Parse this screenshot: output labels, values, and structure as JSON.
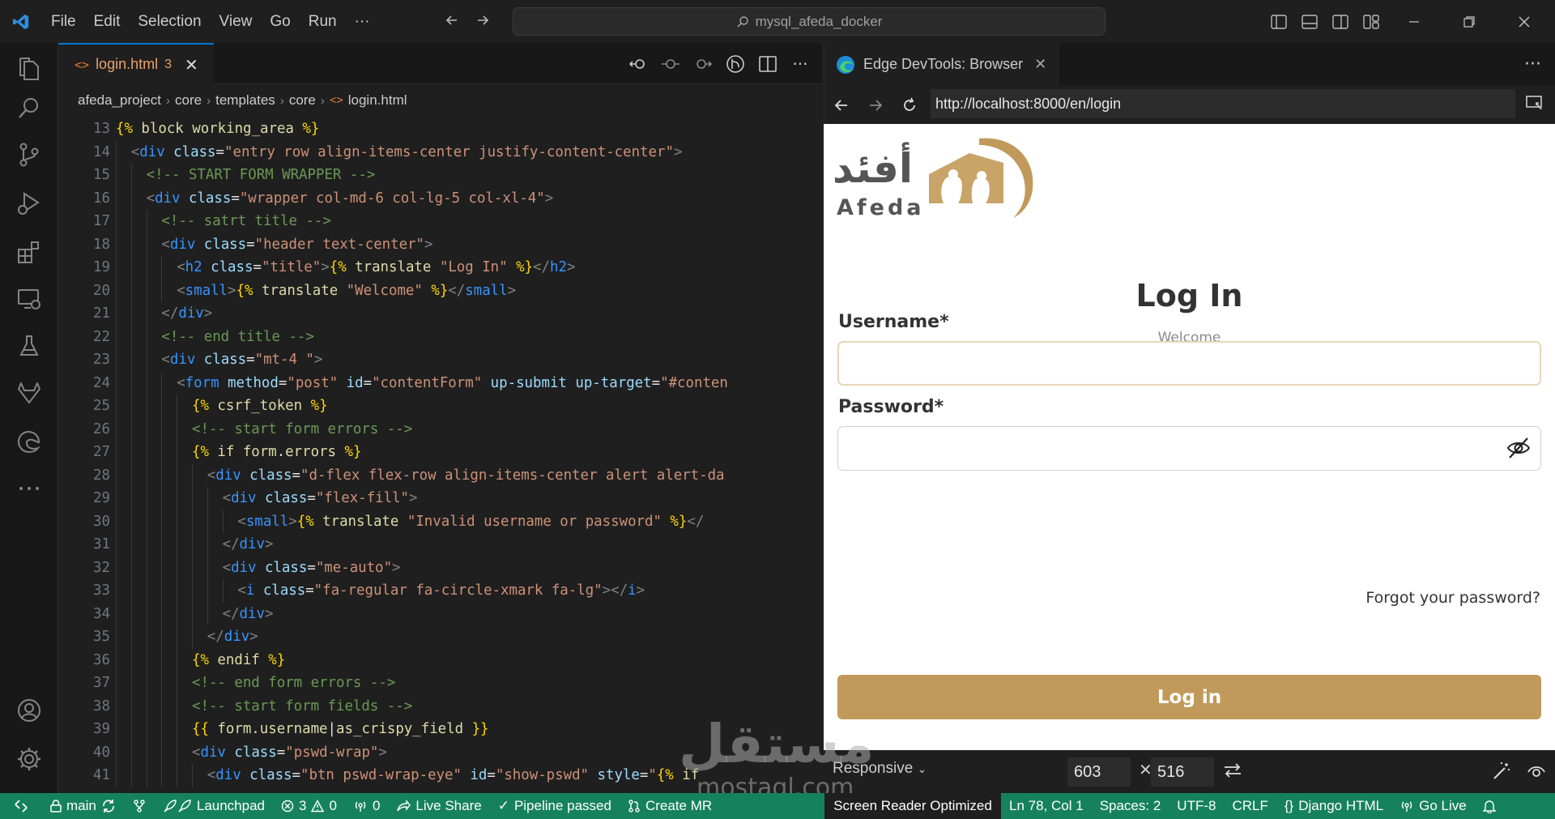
{
  "titlebar": {
    "menu": [
      "File",
      "Edit",
      "Selection",
      "View",
      "Go",
      "Run",
      "···"
    ],
    "search": "mysql_afeda_docker"
  },
  "editor": {
    "tab": {
      "filename": "login.html",
      "problems": "3"
    },
    "breadcrumb": [
      "afeda_project",
      "core",
      "templates",
      "core",
      "login.html"
    ],
    "lines": [
      {
        "n": "13",
        "indent": 0,
        "segs": [
          [
            "t-dj",
            "{% "
          ],
          [
            "t-tpl",
            "block working_area "
          ],
          [
            "t-dj",
            "%}"
          ]
        ]
      },
      {
        "n": "14",
        "indent": 1,
        "segs": [
          [
            "t-br",
            "<"
          ],
          [
            "t-tag",
            "div "
          ],
          [
            "t-attr",
            "class"
          ],
          [
            "t-var",
            "="
          ],
          [
            "t-val",
            "\"entry row align-items-center justify-content-center\""
          ],
          [
            "t-br",
            ">"
          ]
        ]
      },
      {
        "n": "15",
        "indent": 2,
        "segs": [
          [
            "t-cmt",
            "<!-- START FORM WRAPPER -->"
          ]
        ]
      },
      {
        "n": "16",
        "indent": 2,
        "segs": [
          [
            "t-br",
            "<"
          ],
          [
            "t-tag",
            "div "
          ],
          [
            "t-attr",
            "class"
          ],
          [
            "t-var",
            "="
          ],
          [
            "t-val",
            "\"wrapper col-md-6 col-lg-5 col-xl-4\""
          ],
          [
            "t-br",
            ">"
          ]
        ]
      },
      {
        "n": "17",
        "indent": 3,
        "segs": [
          [
            "t-cmt",
            "<!-- satrt title -->"
          ]
        ]
      },
      {
        "n": "18",
        "indent": 3,
        "segs": [
          [
            "t-br",
            "<"
          ],
          [
            "t-tag",
            "div "
          ],
          [
            "t-attr",
            "class"
          ],
          [
            "t-var",
            "="
          ],
          [
            "t-val",
            "\"header text-center\""
          ],
          [
            "t-br",
            ">"
          ]
        ]
      },
      {
        "n": "19",
        "indent": 4,
        "segs": [
          [
            "t-br",
            "<"
          ],
          [
            "t-tag",
            "h2 "
          ],
          [
            "t-attr",
            "class"
          ],
          [
            "t-var",
            "="
          ],
          [
            "t-val",
            "\"title\""
          ],
          [
            "t-br",
            ">"
          ],
          [
            "t-dj",
            "{% "
          ],
          [
            "t-tpl",
            "translate "
          ],
          [
            "t-val",
            "\"Log In\" "
          ],
          [
            "t-dj",
            "%}"
          ],
          [
            "t-br",
            "</"
          ],
          [
            "t-tag",
            "h2"
          ],
          [
            "t-br",
            ">"
          ]
        ]
      },
      {
        "n": "20",
        "indent": 4,
        "segs": [
          [
            "t-br",
            "<"
          ],
          [
            "t-tag",
            "small"
          ],
          [
            "t-br",
            ">"
          ],
          [
            "t-dj",
            "{% "
          ],
          [
            "t-tpl",
            "translate "
          ],
          [
            "t-val",
            "\"Welcome\" "
          ],
          [
            "t-dj",
            "%}"
          ],
          [
            "t-br",
            "</"
          ],
          [
            "t-tag",
            "small"
          ],
          [
            "t-br",
            ">"
          ]
        ]
      },
      {
        "n": "21",
        "indent": 3,
        "segs": [
          [
            "t-br",
            "</"
          ],
          [
            "t-tag",
            "div"
          ],
          [
            "t-br",
            ">"
          ]
        ]
      },
      {
        "n": "22",
        "indent": 3,
        "segs": [
          [
            "t-cmt",
            "<!-- end title -->"
          ]
        ]
      },
      {
        "n": "23",
        "indent": 3,
        "segs": [
          [
            "t-br",
            "<"
          ],
          [
            "t-tag",
            "div "
          ],
          [
            "t-attr",
            "class"
          ],
          [
            "t-var",
            "="
          ],
          [
            "t-val",
            "\"mt-4 \""
          ],
          [
            "t-br",
            ">"
          ]
        ]
      },
      {
        "n": "24",
        "indent": 4,
        "segs": [
          [
            "t-br",
            "<"
          ],
          [
            "t-tag",
            "form "
          ],
          [
            "t-attr",
            "method"
          ],
          [
            "t-var",
            "="
          ],
          [
            "t-val",
            "\"post\" "
          ],
          [
            "t-attr",
            "id"
          ],
          [
            "t-var",
            "="
          ],
          [
            "t-val",
            "\"contentForm\" "
          ],
          [
            "t-attr",
            "up-submit up-target"
          ],
          [
            "t-var",
            "="
          ],
          [
            "t-val",
            "\"#conten"
          ]
        ]
      },
      {
        "n": "25",
        "indent": 5,
        "segs": [
          [
            "t-dj",
            "{% "
          ],
          [
            "t-tpl",
            "csrf_token "
          ],
          [
            "t-dj",
            "%}"
          ]
        ]
      },
      {
        "n": "26",
        "indent": 5,
        "segs": [
          [
            "t-cmt",
            "<!-- start form errors -->"
          ]
        ]
      },
      {
        "n": "27",
        "indent": 5,
        "segs": [
          [
            "t-dj",
            "{% "
          ],
          [
            "t-tpl",
            "if form.errors "
          ],
          [
            "t-dj",
            "%}"
          ]
        ]
      },
      {
        "n": "28",
        "indent": 6,
        "segs": [
          [
            "t-br",
            "<"
          ],
          [
            "t-tag",
            "div "
          ],
          [
            "t-attr",
            "class"
          ],
          [
            "t-var",
            "="
          ],
          [
            "t-val",
            "\"d-flex flex-row align-items-center alert alert-da"
          ]
        ]
      },
      {
        "n": "29",
        "indent": 7,
        "segs": [
          [
            "t-br",
            "<"
          ],
          [
            "t-tag",
            "div "
          ],
          [
            "t-attr",
            "class"
          ],
          [
            "t-var",
            "="
          ],
          [
            "t-val",
            "\"flex-fill\""
          ],
          [
            "t-br",
            ">"
          ]
        ]
      },
      {
        "n": "30",
        "indent": 8,
        "segs": [
          [
            "t-br",
            "<"
          ],
          [
            "t-tag",
            "small"
          ],
          [
            "t-br",
            ">"
          ],
          [
            "t-dj",
            "{% "
          ],
          [
            "t-tpl",
            "translate "
          ],
          [
            "t-val",
            "\"Invalid username or password\" "
          ],
          [
            "t-dj",
            "%}"
          ],
          [
            "t-br",
            "</"
          ]
        ]
      },
      {
        "n": "31",
        "indent": 7,
        "segs": [
          [
            "t-br",
            "</"
          ],
          [
            "t-tag",
            "div"
          ],
          [
            "t-br",
            ">"
          ]
        ]
      },
      {
        "n": "32",
        "indent": 7,
        "segs": [
          [
            "t-br",
            "<"
          ],
          [
            "t-tag",
            "div "
          ],
          [
            "t-attr",
            "class"
          ],
          [
            "t-var",
            "="
          ],
          [
            "t-val",
            "\"me-auto\""
          ],
          [
            "t-br",
            ">"
          ]
        ]
      },
      {
        "n": "33",
        "indent": 8,
        "segs": [
          [
            "t-br",
            "<"
          ],
          [
            "t-tag",
            "i "
          ],
          [
            "t-attr",
            "class"
          ],
          [
            "t-var",
            "="
          ],
          [
            "t-val",
            "\"fa-regular fa-circle-xmark fa-lg\""
          ],
          [
            "t-br",
            "></"
          ],
          [
            "t-tag",
            "i"
          ],
          [
            "t-br",
            ">"
          ]
        ]
      },
      {
        "n": "34",
        "indent": 7,
        "segs": [
          [
            "t-br",
            "</"
          ],
          [
            "t-tag",
            "div"
          ],
          [
            "t-br",
            ">"
          ]
        ]
      },
      {
        "n": "35",
        "indent": 6,
        "segs": [
          [
            "t-br",
            "</"
          ],
          [
            "t-tag",
            "div"
          ],
          [
            "t-br",
            ">"
          ]
        ]
      },
      {
        "n": "36",
        "indent": 5,
        "segs": [
          [
            "t-dj",
            "{% "
          ],
          [
            "t-tpl",
            "endif "
          ],
          [
            "t-dj",
            "%}"
          ]
        ]
      },
      {
        "n": "37",
        "indent": 5,
        "segs": [
          [
            "t-cmt",
            "<!-- end form errors -->"
          ]
        ]
      },
      {
        "n": "38",
        "indent": 5,
        "segs": [
          [
            "t-cmt",
            "<!-- start form fields -->"
          ]
        ]
      },
      {
        "n": "39",
        "indent": 5,
        "segs": [
          [
            "t-dj",
            "{{ "
          ],
          [
            "t-tpl",
            "form.username"
          ],
          [
            "t-var",
            "|"
          ],
          [
            "t-tpl",
            "as_crispy_field "
          ],
          [
            "t-dj",
            "}}"
          ]
        ]
      },
      {
        "n": "40",
        "indent": 5,
        "segs": [
          [
            "t-br",
            "<"
          ],
          [
            "t-tag",
            "div "
          ],
          [
            "t-attr",
            "class"
          ],
          [
            "t-var",
            "="
          ],
          [
            "t-val",
            "\"pswd-wrap\""
          ],
          [
            "t-br",
            ">"
          ]
        ]
      },
      {
        "n": "41",
        "indent": 6,
        "segs": [
          [
            "t-br",
            "<"
          ],
          [
            "t-tag",
            "div "
          ],
          [
            "t-attr",
            "class"
          ],
          [
            "t-var",
            "="
          ],
          [
            "t-val",
            "\"btn pswd-wrap-eye\" "
          ],
          [
            "t-attr",
            "id"
          ],
          [
            "t-var",
            "="
          ],
          [
            "t-val",
            "\"show-pswd\" "
          ],
          [
            "t-attr",
            "style"
          ],
          [
            "t-var",
            "="
          ],
          [
            "t-val",
            "\""
          ],
          [
            "t-dj",
            "{% "
          ],
          [
            "t-tpl",
            "if"
          ]
        ]
      }
    ]
  },
  "devtools": {
    "tab_title": "Edge DevTools: Browser",
    "url": "http://localhost:8000/en/login",
    "page": {
      "logo_arabic": "أفئدة",
      "logo_latin": "Afeda",
      "title": "Log In",
      "subtitle": "Welcome",
      "username_label": "Username*",
      "password_label": "Password*",
      "forgot": "Forgot your password?",
      "login_button": "Log in"
    },
    "bottom": {
      "mode": "Responsive",
      "width": "603",
      "height": "516"
    }
  },
  "statusbar": {
    "branch": "main",
    "launchpad": "Launchpad",
    "errors": "3",
    "warnings": "0",
    "ports": "0",
    "live_share": "Live Share",
    "pipeline": "Pipeline passed",
    "create_mr": "Create MR",
    "screen_reader": "Screen Reader Optimized",
    "position": "Ln 78, Col 1",
    "spaces": "Spaces: 2",
    "encoding": "UTF-8",
    "eol": "CRLF",
    "language": "Django HTML",
    "go_live": "Go Live"
  },
  "watermark": {
    "arabic": "مستقل",
    "latin": "mostaql.com"
  },
  "colors": {
    "accent": "#0078d4",
    "statusbar": "#16825d",
    "brand_gold": "#c19a5b"
  }
}
